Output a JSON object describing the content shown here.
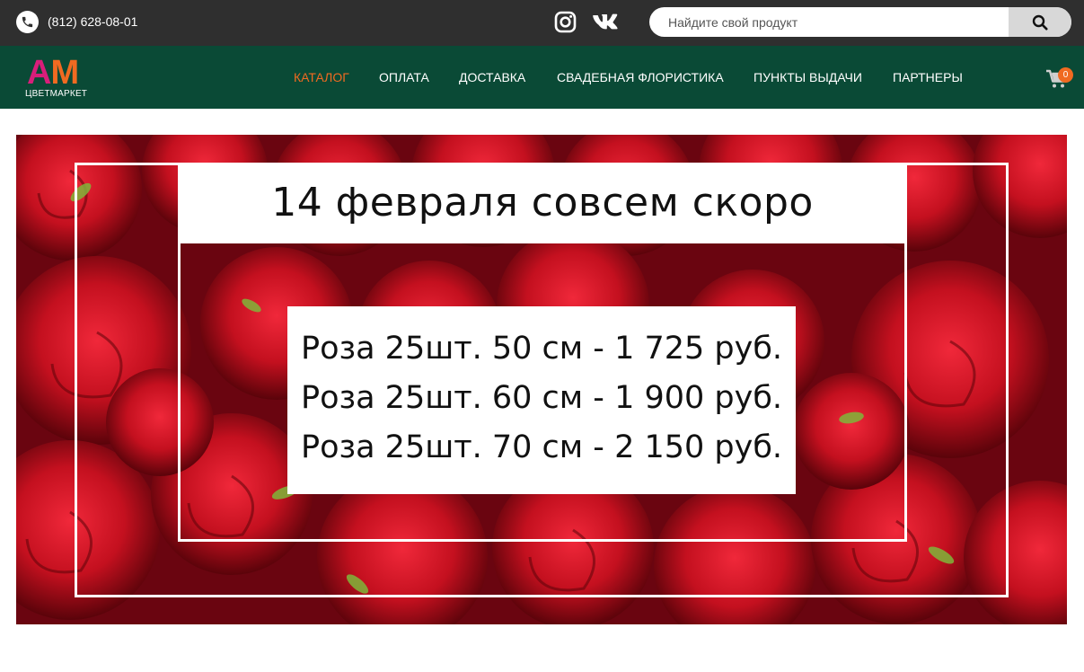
{
  "topbar": {
    "phone": "(812) 628-08-01",
    "phone_icon": "phone-icon",
    "social": [
      {
        "name": "instagram-icon"
      },
      {
        "name": "vk-icon"
      }
    ],
    "search": {
      "placeholder": "Найдите свой продукт",
      "value": "",
      "button_icon": "search-icon"
    }
  },
  "navbar": {
    "logo": {
      "letters": "AM",
      "subtitle": "ЦВЕТМАРКЕТ"
    },
    "items": [
      {
        "label": "КАТАЛОГ",
        "active": true
      },
      {
        "label": "ОПЛАТА",
        "active": false
      },
      {
        "label": "ДОСТАВКА",
        "active": false
      },
      {
        "label": "СВАДЕБНАЯ ФЛОРИСТИКА",
        "active": false
      },
      {
        "label": "ПУНКТЫ ВЫДАЧИ",
        "active": false
      },
      {
        "label": "ПАРТНЕРЫ",
        "active": false
      }
    ],
    "cart": {
      "icon": "cart-icon",
      "count": "0"
    }
  },
  "banner": {
    "title": "14 февраля совсем скоро",
    "prices": [
      "Роза 25шт. 50 см - 1 725 руб.",
      "Роза 25шт. 60 см - 1 900 руб.",
      "Роза 25шт. 70 см - 2 150 руб."
    ]
  },
  "colors": {
    "topbar_bg": "#2f2f2f",
    "navbar_bg": "#0a4a36",
    "accent": "#f06a21",
    "logo_pink": "#d81e7a"
  }
}
